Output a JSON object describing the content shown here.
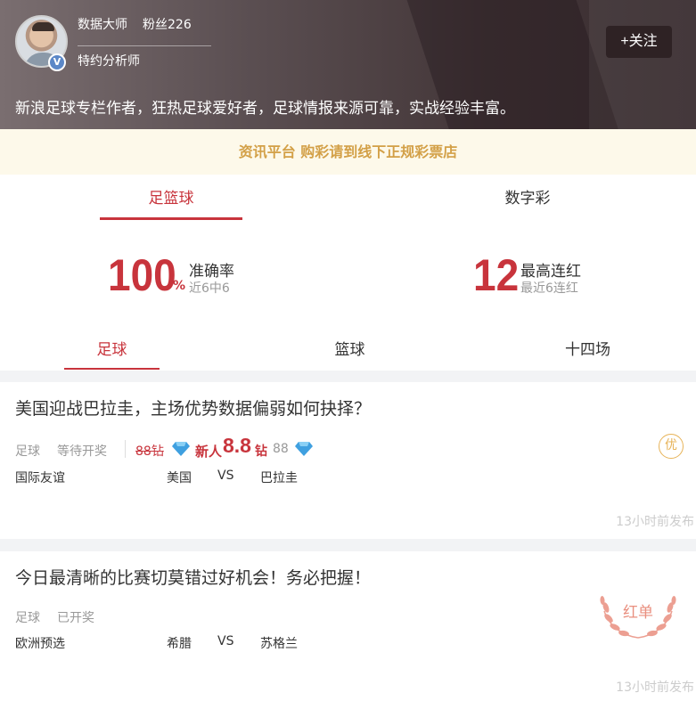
{
  "profile": {
    "name": "数据大师",
    "fans": "粉丝226",
    "role": "特约分析师",
    "badge": "V",
    "follow_label": "+关注",
    "bio": "新浪足球专栏作者，狂热足球爱好者，足球情报来源可靠，实战经验丰富。"
  },
  "notice": "资讯平台 购彩请到线下正规彩票店",
  "category_tabs": [
    {
      "label": "足篮球",
      "active": true
    },
    {
      "label": "数字彩",
      "active": false
    }
  ],
  "stats": {
    "accuracy_value": "100",
    "accuracy_unit": "%",
    "accuracy_label": "准确率",
    "accuracy_sub": "近6中6",
    "streak_value": "12",
    "streak_label": "最高连红",
    "streak_sub": "最近6连红"
  },
  "sport_tabs": [
    {
      "label": "足球",
      "active": true
    },
    {
      "label": "篮球",
      "active": false
    },
    {
      "label": "十四场",
      "active": false
    }
  ],
  "articles": [
    {
      "title": "美国迎战巴拉圭，主场优势数据偏弱如何抉择？",
      "sport": "足球",
      "status": "等待开奖",
      "original_price": "88钻",
      "newbie_label": "新人",
      "price": "8.8",
      "price_unit": "钻",
      "price_plain": "88",
      "league": "国际友谊",
      "home": "美国",
      "vs": "VS",
      "away": "巴拉圭",
      "badge": "优",
      "time": "13小时前发布"
    },
    {
      "title": "今日最清晰的比赛切莫错过好机会！务必把握！",
      "sport": "足球",
      "status": "已开奖",
      "league": "欧洲预选",
      "home": "希腊",
      "vs": "VS",
      "away": "苏格兰",
      "badge": "红单",
      "time": "13小时前发布"
    }
  ],
  "colors": {
    "accent": "#c8343c",
    "notice_text": "#d3a047",
    "notice_bg": "#fdf9ea",
    "gem": "#3fa0e0",
    "badge_gold": "#e7b358",
    "laurel": "#e98f7f"
  }
}
